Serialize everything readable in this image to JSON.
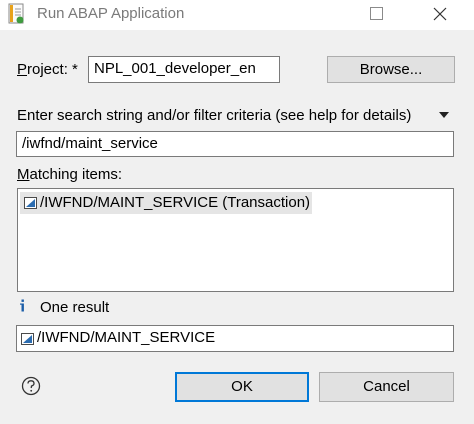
{
  "window": {
    "title": "Run ABAP Application",
    "icons": {
      "app": "abap-app-icon",
      "maximize": "maximize-icon",
      "close": "close-icon"
    }
  },
  "project": {
    "label_mnemonic": "P",
    "label_rest": "roject: *",
    "value": "NPL_001_developer_en",
    "browse_label": "Browse..."
  },
  "filter": {
    "label": "Enter search string and/or filter criteria (see help for details)",
    "menu_icon": "dropdown-arrow-icon",
    "value": "/iwfnd/maint_service"
  },
  "matching": {
    "label_mnemonic": "M",
    "label_rest": "atching items:",
    "items": [
      {
        "text": "/IWFND/MAINT_SERVICE (Transaction)",
        "icon": "transaction-icon"
      }
    ]
  },
  "result": {
    "info_icon": "info-icon",
    "text": "One result",
    "selected": "/IWFND/MAINT_SERVICE",
    "icon": "transaction-icon"
  },
  "footer": {
    "help_icon": "help-icon",
    "ok_label": "OK",
    "cancel_label": "Cancel"
  },
  "colors": {
    "accent": "#0078d7",
    "window_bg": "#f0f0f0",
    "selection_bg": "#e5e5e5"
  }
}
